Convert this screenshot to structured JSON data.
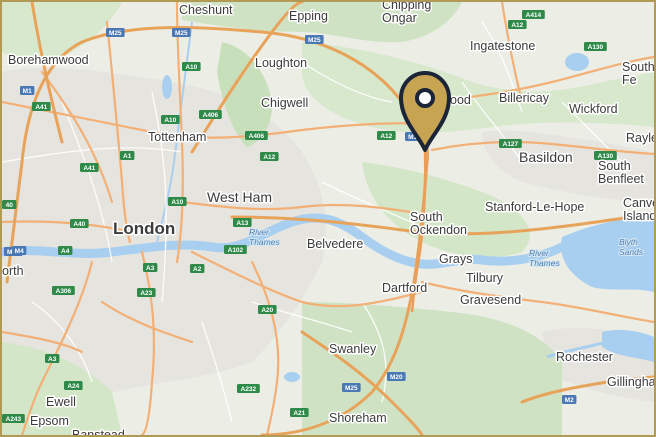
{
  "map": {
    "accent_color": "#c7a451",
    "marker": {
      "name": "location-pin",
      "fill": "#c7a451",
      "outline": "#1c2437"
    },
    "places": [
      {
        "id": "cheshunt",
        "label": "Cheshunt"
      },
      {
        "id": "epping",
        "label": "Epping"
      },
      {
        "id": "chipping-ongar",
        "label": "Chipping\nOngar"
      },
      {
        "id": "ingatestone",
        "label": "Ingatestone"
      },
      {
        "id": "borehamwood",
        "label": "Borehamwood"
      },
      {
        "id": "loughton",
        "label": "Loughton"
      },
      {
        "id": "south-woodham-ferrers",
        "label": "South W\nFe"
      },
      {
        "id": "chigwell",
        "label": "Chigwell"
      },
      {
        "id": "brentwood",
        "label": "ood"
      },
      {
        "id": "billericay",
        "label": "Billericay"
      },
      {
        "id": "wickford",
        "label": "Wickford"
      },
      {
        "id": "tottenham",
        "label": "Tottenham"
      },
      {
        "id": "basildon",
        "label": "Basildon"
      },
      {
        "id": "rayleigh",
        "label": "Rayle"
      },
      {
        "id": "south-benfleet",
        "label": "South\nBenfleet"
      },
      {
        "id": "west-ham",
        "label": "West Ham"
      },
      {
        "id": "stanford-le-hope",
        "label": "Stanford-Le-Hope"
      },
      {
        "id": "canvey-island",
        "label": "Canvey\nIsland"
      },
      {
        "id": "london",
        "label": "London"
      },
      {
        "id": "belvedere",
        "label": "Belvedere"
      },
      {
        "id": "south-ockendon",
        "label": "South\nOckendon"
      },
      {
        "id": "grays",
        "label": "Grays"
      },
      {
        "id": "tilbury",
        "label": "Tilbury"
      },
      {
        "id": "dartford",
        "label": "Dartford"
      },
      {
        "id": "gravesend",
        "label": "Gravesend"
      },
      {
        "id": "worth",
        "label": "orth"
      },
      {
        "id": "swanley",
        "label": "Swanley"
      },
      {
        "id": "rochester",
        "label": "Rochester"
      },
      {
        "id": "gillingham",
        "label": "Gillingham"
      },
      {
        "id": "ewell",
        "label": "Ewell"
      },
      {
        "id": "epsom",
        "label": "Epsom"
      },
      {
        "id": "banstead",
        "label": "Banstead"
      },
      {
        "id": "shoreham",
        "label": "Shoreham"
      }
    ],
    "water_labels": [
      {
        "id": "river-thames-1",
        "label": "River\nThames"
      },
      {
        "id": "river-thames-2",
        "label": "River\nThames"
      },
      {
        "id": "blyth-sands",
        "label": "Blyth\nSands"
      }
    ],
    "road_shields": [
      {
        "id": "m25-1",
        "label": "M25",
        "kind": "motorway"
      },
      {
        "id": "m25-2",
        "label": "M25",
        "kind": "motorway"
      },
      {
        "id": "m25-3",
        "label": "M25",
        "kind": "motorway"
      },
      {
        "id": "m25-4",
        "label": "M25",
        "kind": "motorway"
      },
      {
        "id": "m25-5",
        "label": "M25",
        "kind": "motorway"
      },
      {
        "id": "m1",
        "label": "M1",
        "kind": "motorway"
      },
      {
        "id": "m11",
        "label": "M11",
        "kind": "motorway"
      },
      {
        "id": "m4",
        "label": "M4",
        "kind": "motorway"
      },
      {
        "id": "m2",
        "label": "M2",
        "kind": "motorway"
      },
      {
        "id": "m20",
        "label": "M20",
        "kind": "motorway"
      },
      {
        "id": "a414",
        "label": "A414",
        "kind": "primary"
      },
      {
        "id": "a12-1",
        "label": "A12",
        "kind": "primary"
      },
      {
        "id": "a130-1",
        "label": "A130",
        "kind": "primary"
      },
      {
        "id": "a10-1",
        "label": "A10",
        "kind": "primary"
      },
      {
        "id": "a41",
        "label": "A41",
        "kind": "primary"
      },
      {
        "id": "a10-2",
        "label": "A10",
        "kind": "primary"
      },
      {
        "id": "a406-1",
        "label": "A406",
        "kind": "primary"
      },
      {
        "id": "a406-2",
        "label": "A406",
        "kind": "primary"
      },
      {
        "id": "a12-2",
        "label": "A12",
        "kind": "primary"
      },
      {
        "id": "a127",
        "label": "A127",
        "kind": "primary"
      },
      {
        "id": "a130-2",
        "label": "A130",
        "kind": "primary"
      },
      {
        "id": "a1",
        "label": "A1",
        "kind": "primary"
      },
      {
        "id": "a41-2",
        "label": "A41",
        "kind": "primary"
      },
      {
        "id": "a10-3",
        "label": "A10",
        "kind": "primary"
      },
      {
        "id": "a13",
        "label": "A13",
        "kind": "primary"
      },
      {
        "id": "a40",
        "label": "A40",
        "kind": "primary"
      },
      {
        "id": "a4",
        "label": "A4",
        "kind": "primary"
      },
      {
        "id": "a102",
        "label": "A102",
        "kind": "primary"
      },
      {
        "id": "a3",
        "label": "A3",
        "kind": "primary"
      },
      {
        "id": "a2",
        "label": "A2",
        "kind": "primary"
      },
      {
        "id": "a306",
        "label": "A306",
        "kind": "primary"
      },
      {
        "id": "a23",
        "label": "A23",
        "kind": "primary"
      },
      {
        "id": "a20",
        "label": "A20",
        "kind": "primary"
      },
      {
        "id": "a3-2",
        "label": "A3",
        "kind": "primary"
      },
      {
        "id": "a24",
        "label": "A24",
        "kind": "primary"
      },
      {
        "id": "a232",
        "label": "A232",
        "kind": "primary"
      },
      {
        "id": "a21",
        "label": "A21",
        "kind": "primary"
      },
      {
        "id": "a243",
        "label": "A243",
        "kind": "primary"
      },
      {
        "id": "a12-3",
        "label": "A12",
        "kind": "primary"
      },
      {
        "id": "a40-2",
        "label": "40",
        "kind": "primary"
      }
    ]
  }
}
